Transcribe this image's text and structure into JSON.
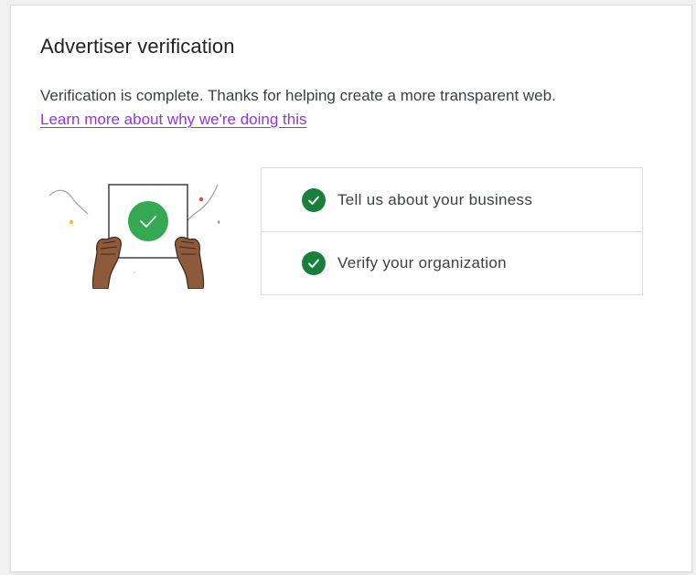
{
  "page": {
    "title": "Advertiser verification",
    "description": "Verification is complete. Thanks for helping create a more transparent web.",
    "learn_more_link": "Learn more about why we're doing this"
  },
  "steps": [
    {
      "label": "Tell us about your business",
      "status": "complete",
      "icon": "check-circle-icon"
    },
    {
      "label": "Verify your organization",
      "status": "complete",
      "icon": "check-circle-icon"
    }
  ],
  "colors": {
    "check_green": "#188038",
    "link_purple": "#9334e6",
    "illustration_green": "#34a853",
    "skin": "#8d5a3b"
  }
}
